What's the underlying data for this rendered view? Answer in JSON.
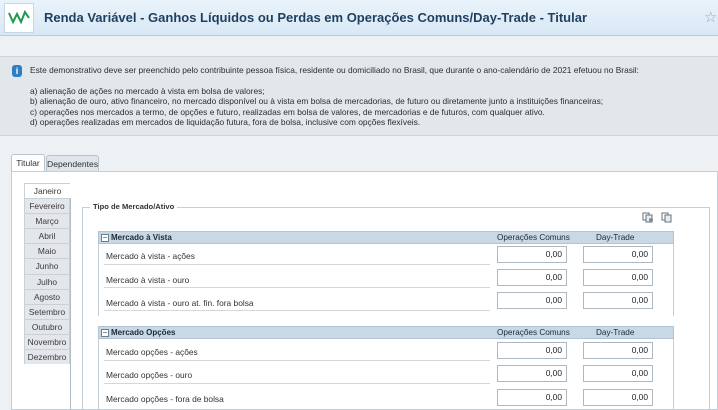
{
  "header": {
    "title": "Renda Variável - Ganhos Líquidos ou Perdas em Operações Comuns/Day-Trade - Titular"
  },
  "info": {
    "intro": "Este demonstrativo deve ser preenchido pelo contribuinte pessoa física, residente ou domiciliado no Brasil, que durante o ano-calendário de 2021 efetuou no Brasil:",
    "items": [
      "a) alienação de ações no mercado à vista em bolsa de valores;",
      "b) alienação de ouro, ativo financeiro, no mercado disponível ou à vista em bolsa de mercadorias, de futuro ou diretamente junto a instituições financeiras;",
      "c) operações nos mercados a termo, de opções e futuro, realizadas em bolsa de valores, de mercadorias e de futuros, com qualquer ativo.",
      "d) operações realizadas em mercados de liquidação futura, fora de bolsa, inclusive com opções flexíveis."
    ]
  },
  "tabs": [
    "Titular",
    "Dependentes"
  ],
  "months": [
    "Janeiro",
    "Fevereiro",
    "Março",
    "Abril",
    "Maio",
    "Junho",
    "Julho",
    "Agosto",
    "Setembro",
    "Outubro",
    "Novembro",
    "Dezembro"
  ],
  "fieldset": {
    "legend": "Tipo de Mercado/Ativo"
  },
  "sections": [
    {
      "title": "Mercado à Vista",
      "col_oc": "Operações Comuns",
      "col_dt": "Day-Trade",
      "rows": [
        {
          "label": "Mercado à vista - ações",
          "oc": "0,00",
          "dt": "0,00"
        },
        {
          "label": "Mercado à vista - ouro",
          "oc": "0,00",
          "dt": "0,00"
        },
        {
          "label": "Mercado à vista - ouro at. fin. fora bolsa",
          "oc": "0,00",
          "dt": "0,00"
        }
      ]
    },
    {
      "title": "Mercado Opções",
      "col_oc": "Operações Comuns",
      "col_dt": "Day-Trade",
      "rows": [
        {
          "label": "Mercado opções - ações",
          "oc": "0,00",
          "dt": "0,00"
        },
        {
          "label": "Mercado opções - ouro",
          "oc": "0,00",
          "dt": "0,00"
        },
        {
          "label": "Mercado opções - fora de bolsa",
          "oc": "0,00",
          "dt": "0,00"
        }
      ]
    }
  ]
}
